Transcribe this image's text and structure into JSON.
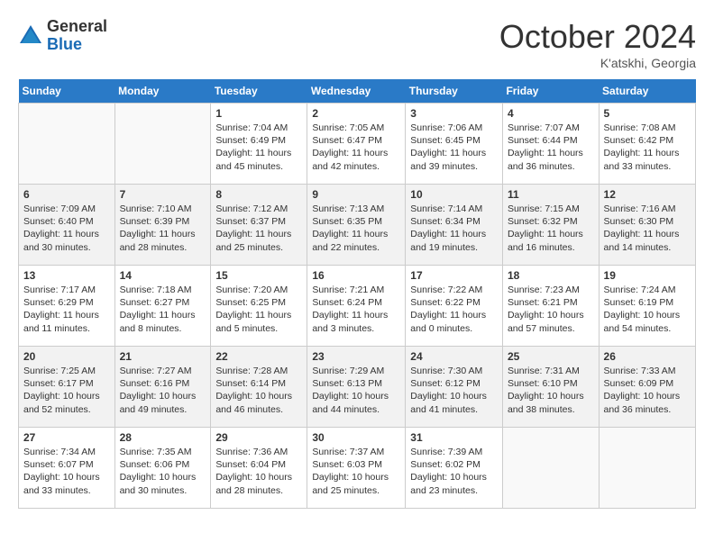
{
  "header": {
    "logo_general": "General",
    "logo_blue": "Blue",
    "title": "October 2024",
    "location": "K'atskhi, Georgia"
  },
  "weekdays": [
    "Sunday",
    "Monday",
    "Tuesday",
    "Wednesday",
    "Thursday",
    "Friday",
    "Saturday"
  ],
  "weeks": [
    [
      {
        "day": "",
        "info": ""
      },
      {
        "day": "",
        "info": ""
      },
      {
        "day": "1",
        "info": "Sunrise: 7:04 AM\nSunset: 6:49 PM\nDaylight: 11 hours and 45 minutes."
      },
      {
        "day": "2",
        "info": "Sunrise: 7:05 AM\nSunset: 6:47 PM\nDaylight: 11 hours and 42 minutes."
      },
      {
        "day": "3",
        "info": "Sunrise: 7:06 AM\nSunset: 6:45 PM\nDaylight: 11 hours and 39 minutes."
      },
      {
        "day": "4",
        "info": "Sunrise: 7:07 AM\nSunset: 6:44 PM\nDaylight: 11 hours and 36 minutes."
      },
      {
        "day": "5",
        "info": "Sunrise: 7:08 AM\nSunset: 6:42 PM\nDaylight: 11 hours and 33 minutes."
      }
    ],
    [
      {
        "day": "6",
        "info": "Sunrise: 7:09 AM\nSunset: 6:40 PM\nDaylight: 11 hours and 30 minutes."
      },
      {
        "day": "7",
        "info": "Sunrise: 7:10 AM\nSunset: 6:39 PM\nDaylight: 11 hours and 28 minutes."
      },
      {
        "day": "8",
        "info": "Sunrise: 7:12 AM\nSunset: 6:37 PM\nDaylight: 11 hours and 25 minutes."
      },
      {
        "day": "9",
        "info": "Sunrise: 7:13 AM\nSunset: 6:35 PM\nDaylight: 11 hours and 22 minutes."
      },
      {
        "day": "10",
        "info": "Sunrise: 7:14 AM\nSunset: 6:34 PM\nDaylight: 11 hours and 19 minutes."
      },
      {
        "day": "11",
        "info": "Sunrise: 7:15 AM\nSunset: 6:32 PM\nDaylight: 11 hours and 16 minutes."
      },
      {
        "day": "12",
        "info": "Sunrise: 7:16 AM\nSunset: 6:30 PM\nDaylight: 11 hours and 14 minutes."
      }
    ],
    [
      {
        "day": "13",
        "info": "Sunrise: 7:17 AM\nSunset: 6:29 PM\nDaylight: 11 hours and 11 minutes."
      },
      {
        "day": "14",
        "info": "Sunrise: 7:18 AM\nSunset: 6:27 PM\nDaylight: 11 hours and 8 minutes."
      },
      {
        "day": "15",
        "info": "Sunrise: 7:20 AM\nSunset: 6:25 PM\nDaylight: 11 hours and 5 minutes."
      },
      {
        "day": "16",
        "info": "Sunrise: 7:21 AM\nSunset: 6:24 PM\nDaylight: 11 hours and 3 minutes."
      },
      {
        "day": "17",
        "info": "Sunrise: 7:22 AM\nSunset: 6:22 PM\nDaylight: 11 hours and 0 minutes."
      },
      {
        "day": "18",
        "info": "Sunrise: 7:23 AM\nSunset: 6:21 PM\nDaylight: 10 hours and 57 minutes."
      },
      {
        "day": "19",
        "info": "Sunrise: 7:24 AM\nSunset: 6:19 PM\nDaylight: 10 hours and 54 minutes."
      }
    ],
    [
      {
        "day": "20",
        "info": "Sunrise: 7:25 AM\nSunset: 6:17 PM\nDaylight: 10 hours and 52 minutes."
      },
      {
        "day": "21",
        "info": "Sunrise: 7:27 AM\nSunset: 6:16 PM\nDaylight: 10 hours and 49 minutes."
      },
      {
        "day": "22",
        "info": "Sunrise: 7:28 AM\nSunset: 6:14 PM\nDaylight: 10 hours and 46 minutes."
      },
      {
        "day": "23",
        "info": "Sunrise: 7:29 AM\nSunset: 6:13 PM\nDaylight: 10 hours and 44 minutes."
      },
      {
        "day": "24",
        "info": "Sunrise: 7:30 AM\nSunset: 6:12 PM\nDaylight: 10 hours and 41 minutes."
      },
      {
        "day": "25",
        "info": "Sunrise: 7:31 AM\nSunset: 6:10 PM\nDaylight: 10 hours and 38 minutes."
      },
      {
        "day": "26",
        "info": "Sunrise: 7:33 AM\nSunset: 6:09 PM\nDaylight: 10 hours and 36 minutes."
      }
    ],
    [
      {
        "day": "27",
        "info": "Sunrise: 7:34 AM\nSunset: 6:07 PM\nDaylight: 10 hours and 33 minutes."
      },
      {
        "day": "28",
        "info": "Sunrise: 7:35 AM\nSunset: 6:06 PM\nDaylight: 10 hours and 30 minutes."
      },
      {
        "day": "29",
        "info": "Sunrise: 7:36 AM\nSunset: 6:04 PM\nDaylight: 10 hours and 28 minutes."
      },
      {
        "day": "30",
        "info": "Sunrise: 7:37 AM\nSunset: 6:03 PM\nDaylight: 10 hours and 25 minutes."
      },
      {
        "day": "31",
        "info": "Sunrise: 7:39 AM\nSunset: 6:02 PM\nDaylight: 10 hours and 23 minutes."
      },
      {
        "day": "",
        "info": ""
      },
      {
        "day": "",
        "info": ""
      }
    ]
  ]
}
